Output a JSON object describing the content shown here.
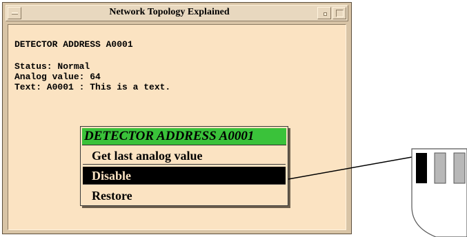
{
  "window": {
    "title": "Network Topology Explained"
  },
  "detector": {
    "title": "DETECTOR ADDRESS A0001",
    "status_line": "Status: Normal",
    "analog_line": "Analog value: 64",
    "text_line": "Text: A0001 : This is a text."
  },
  "popup_menu": {
    "title": "DETECTOR ADDRESS A0001",
    "items": [
      {
        "label": "Get last analog value",
        "selected": false
      },
      {
        "label": "Disable",
        "selected": true
      },
      {
        "label": "Restore",
        "selected": false
      }
    ]
  },
  "colors": {
    "window_frame": "#d8c4a6",
    "content_background": "#fbe3c2",
    "popup_title_background": "#3ac23a",
    "selected_item_background": "#000000"
  }
}
